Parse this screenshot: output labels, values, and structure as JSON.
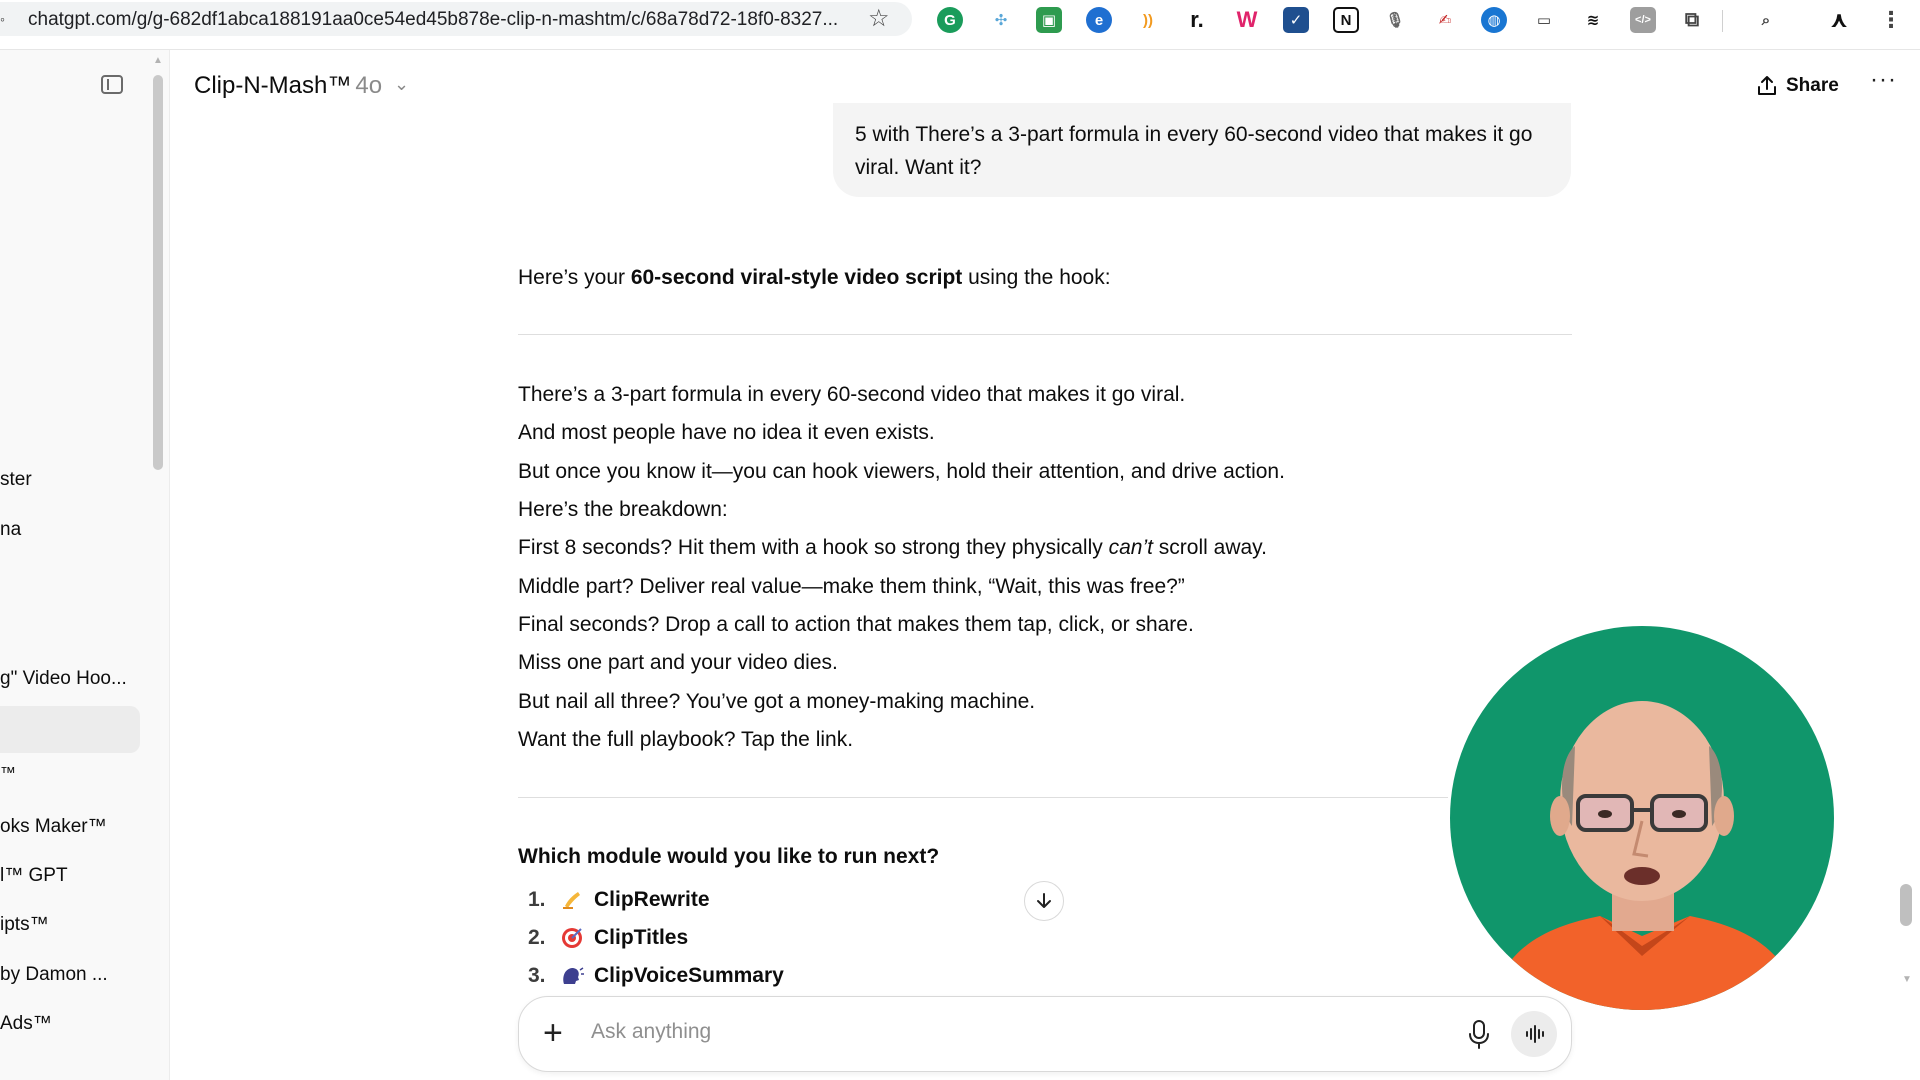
{
  "browser": {
    "url": "chatgpt.com/g/g-682df1abca188191aa0ce54ed45b878e-clip-n-mashtm/c/68a78d72-18f0-8327..."
  },
  "sidebar": {
    "items": [
      "ster",
      "na",
      "g\" Video Hoo...",
      "™",
      "oks Maker™",
      "l™ GPT",
      "ipts™",
      "by Damon ...",
      "Ads™"
    ]
  },
  "header": {
    "title": "Clip-N-Mash™",
    "model": "4o",
    "share_label": "Share"
  },
  "conversation": {
    "user_message": "5 with There’s a 3-part formula in every 60-second video that makes it go viral. Want it?",
    "intro_prefix": "Here’s your ",
    "intro_bold": "60-second viral-style video script",
    "intro_suffix": " using the hook:",
    "script_lines": [
      "There’s a 3-part formula in every 60-second video that makes it go viral.",
      "And most people have no idea it even exists.",
      "But once you know it—you can hook viewers, hold their attention, and drive action.",
      "Here’s the breakdown:",
      "First 8 seconds? Hit them with a hook so strong they physically ",
      "Middle part? Deliver real value—make them think, “Wait, this was free?”",
      "Final seconds? Drop a call to action that makes them tap, click, or share.",
      "Miss one part and your video dies.",
      "But nail all three? You’ve got a money-making machine.",
      "Want the full playbook? Tap the link."
    ],
    "line5_emphasis": "can’t",
    "line5_suffix": " scroll away.",
    "question": "Which module would you like to run next?",
    "modules": [
      {
        "number": "1.",
        "label": "ClipRewrite",
        "icon": "writing-hand-icon"
      },
      {
        "number": "2.",
        "label": "ClipTitles",
        "icon": "target-icon"
      },
      {
        "number": "3.",
        "label": "ClipVoiceSummary",
        "icon": "speaking-head-icon"
      }
    ]
  },
  "composer": {
    "placeholder": "Ask anything"
  },
  "colors": {
    "webcam_bg": "#10966b",
    "shirt": "#f2622a",
    "bubble_bg": "#f4f4f4"
  }
}
